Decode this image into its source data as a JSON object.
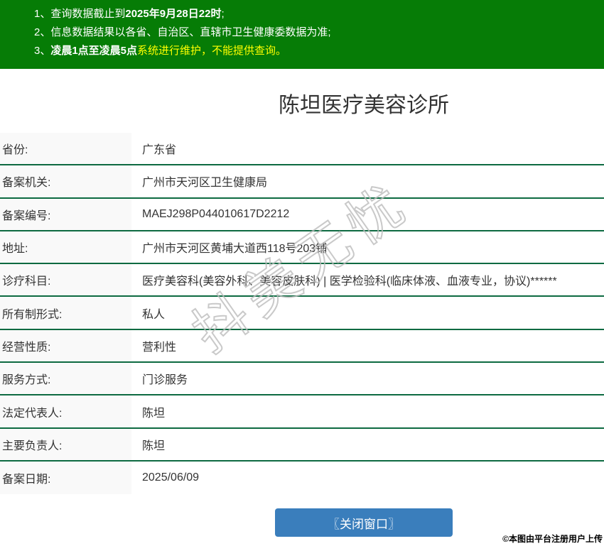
{
  "colors": {
    "notice_bg": "#067c06",
    "notice_highlight": "#ffff00",
    "row_divider_green": "#0d6a41",
    "label_bg": "#f9f9f9",
    "text": "#333333",
    "button_bg": "#3a7ebc",
    "watermark_stroke": "#bbbbbb"
  },
  "notice": {
    "line1": {
      "num": "1、",
      "pre": "查询数据截止到",
      "bold": "2025年9月28日22时",
      "suf": ";"
    },
    "line2": {
      "num": "2、",
      "text": "信息数据结果以各省、自治区、直辖市卫生健康委数据为准;"
    },
    "line3": {
      "num": "3、",
      "bold": "凌晨1点至凌晨5点",
      "rest": "系统进行维护，不能提供查询。"
    }
  },
  "header": {
    "title": "陈坦医疗美容诊所"
  },
  "table": {
    "rows": [
      {
        "label": "省份:",
        "value": "广东省"
      },
      {
        "label": "备案机关:",
        "value": "广州市天河区卫生健康局"
      },
      {
        "label": "备案编号:",
        "value": "MAEJ298P044010617D2212"
      },
      {
        "label": "地址:",
        "value": "广州市天河区黄埔大道西118号203铺"
      },
      {
        "label": "诊疗科目:",
        "value": "医疗美容科(美容外科、美容皮肤科) | 医学检验科(临床体液、血液专业，协议)******"
      },
      {
        "label": "所有制形式:",
        "value": "私人"
      },
      {
        "label": "经营性质:",
        "value": "营利性"
      },
      {
        "label": "服务方式:",
        "value": "门诊服务"
      },
      {
        "label": "法定代表人:",
        "value": "陈坦"
      },
      {
        "label": "主要负责人:",
        "value": "陈坦"
      },
      {
        "label": "备案日期:",
        "value": "2025/06/09"
      }
    ]
  },
  "footer": {
    "close_button_label": "〖关闭窗口〗",
    "credit": "©本图由平台注册用户上传"
  },
  "watermark": {
    "text": "抖美无忧"
  }
}
